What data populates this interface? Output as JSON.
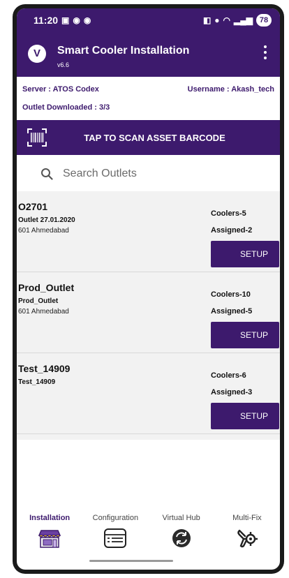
{
  "status_bar": {
    "time": "11:20",
    "battery": "78"
  },
  "app_bar": {
    "title": "Smart Cooler Installation",
    "version": "v6.6"
  },
  "info": {
    "server": "Server : ATOS Codex",
    "username": "Username : Akash_tech",
    "outlet_downloaded": "Outlet Downloaded : 3/3"
  },
  "scan": {
    "label": "TAP TO SCAN ASSET BARCODE"
  },
  "search": {
    "placeholder": "Search Outlets"
  },
  "outlets": [
    {
      "code": "O2701",
      "name": "Outlet 27.01.2020",
      "address": "601 Ahmedabad",
      "coolers": "Coolers-5",
      "assigned": "Assigned-2",
      "button": "SETUP"
    },
    {
      "code": "Prod_Outlet",
      "name": "Prod_Outlet",
      "address": "601 Ahmedabad",
      "coolers": "Coolers-10",
      "assigned": "Assigned-5",
      "button": "SETUP"
    },
    {
      "code": "Test_14909",
      "name": "Test_14909",
      "address": "",
      "coolers": "Coolers-6",
      "assigned": "Assigned-3",
      "button": "SETUP"
    }
  ],
  "bottom_nav": [
    {
      "label": "Installation",
      "icon": "store-icon",
      "active": true
    },
    {
      "label": "Configuration",
      "icon": "list-icon",
      "active": false
    },
    {
      "label": "Virtual Hub",
      "icon": "sync-icon",
      "active": false
    },
    {
      "label": "Multi-Fix",
      "icon": "tools-icon",
      "active": false
    }
  ],
  "colors": {
    "primary": "#3d1a6d",
    "list_background": "#f2f2f2"
  }
}
